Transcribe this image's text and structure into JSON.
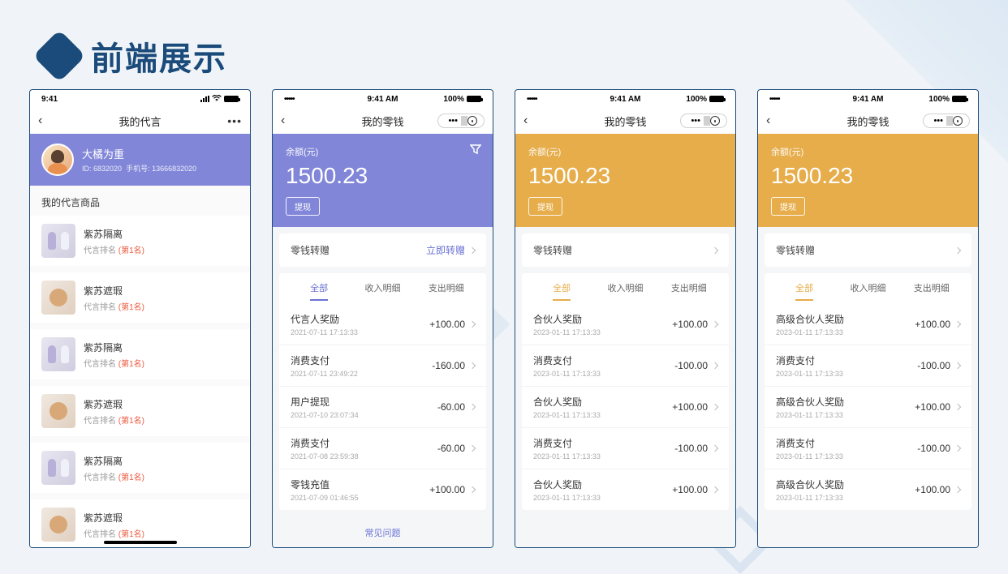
{
  "page": {
    "title": "前端展示"
  },
  "status": {
    "time_left": "9:41",
    "time_center": "9:41 AM",
    "pct": "100%",
    "carrier": "•••••"
  },
  "phone1": {
    "nav_title": "我的代言",
    "user": {
      "name": "大橘为重",
      "id_label": "ID: 6832020",
      "phone_label": "手机号: 13666832020"
    },
    "section": "我的代言商品",
    "rank_prefix": "代言排名 ",
    "items": [
      {
        "title": "紫苏隔离",
        "rank": "(第1名)"
      },
      {
        "title": "紫苏遮瑕",
        "rank": "(第1名)"
      },
      {
        "title": "紫苏隔离",
        "rank": "(第1名)"
      },
      {
        "title": "紫苏遮瑕",
        "rank": "(第1名)"
      },
      {
        "title": "紫苏隔离",
        "rank": "(第1名)"
      },
      {
        "title": "紫苏遮瑕",
        "rank": "(第1名)"
      }
    ]
  },
  "wallet_nav_title": "我的零钱",
  "balance": {
    "label": "余额(元)",
    "amount": "1500.23",
    "withdraw": "提现"
  },
  "transfer_row": {
    "label": "零钱转赠",
    "action": "立即转赠"
  },
  "tabs": {
    "all": "全部",
    "income": "收入明细",
    "expense": "支出明细"
  },
  "faq": "常见问题",
  "phone2": {
    "tx": [
      {
        "title": "代言人奖励",
        "time": "2021-07-11 17:13:33",
        "amt": "+100.00"
      },
      {
        "title": "消费支付",
        "time": "2021-07-11 23:49:22",
        "amt": "-160.00"
      },
      {
        "title": "用户提现",
        "time": "2021-07-10 23:07:34",
        "amt": "-60.00"
      },
      {
        "title": "消费支付",
        "time": "2021-07-08 23:59:38",
        "amt": "-60.00"
      },
      {
        "title": "零钱充值",
        "time": "2021-07-09 01:46:55",
        "amt": "+100.00"
      }
    ]
  },
  "phone3": {
    "tx": [
      {
        "title": "合伙人奖励",
        "time": "2023-01-11 17:13:33",
        "amt": "+100.00"
      },
      {
        "title": "消费支付",
        "time": "2023-01-11 17:13:33",
        "amt": "-100.00"
      },
      {
        "title": "合伙人奖励",
        "time": "2023-01-11 17:13:33",
        "amt": "+100.00"
      },
      {
        "title": "消费支付",
        "time": "2023-01-11 17:13:33",
        "amt": "-100.00"
      },
      {
        "title": "合伙人奖励",
        "time": "2023-01-11 17:13:33",
        "amt": "+100.00"
      }
    ]
  },
  "phone4": {
    "tx": [
      {
        "title": "高级合伙人奖励",
        "time": "2023-01-11 17:13:33",
        "amt": "+100.00"
      },
      {
        "title": "消费支付",
        "time": "2023-01-11 17:13:33",
        "amt": "-100.00"
      },
      {
        "title": "高级合伙人奖励",
        "time": "2023-01-11 17:13:33",
        "amt": "+100.00"
      },
      {
        "title": "消费支付",
        "time": "2023-01-11 17:13:33",
        "amt": "-100.00"
      },
      {
        "title": "高级合伙人奖励",
        "time": "2023-01-11 17:13:33",
        "amt": "+100.00"
      }
    ]
  }
}
